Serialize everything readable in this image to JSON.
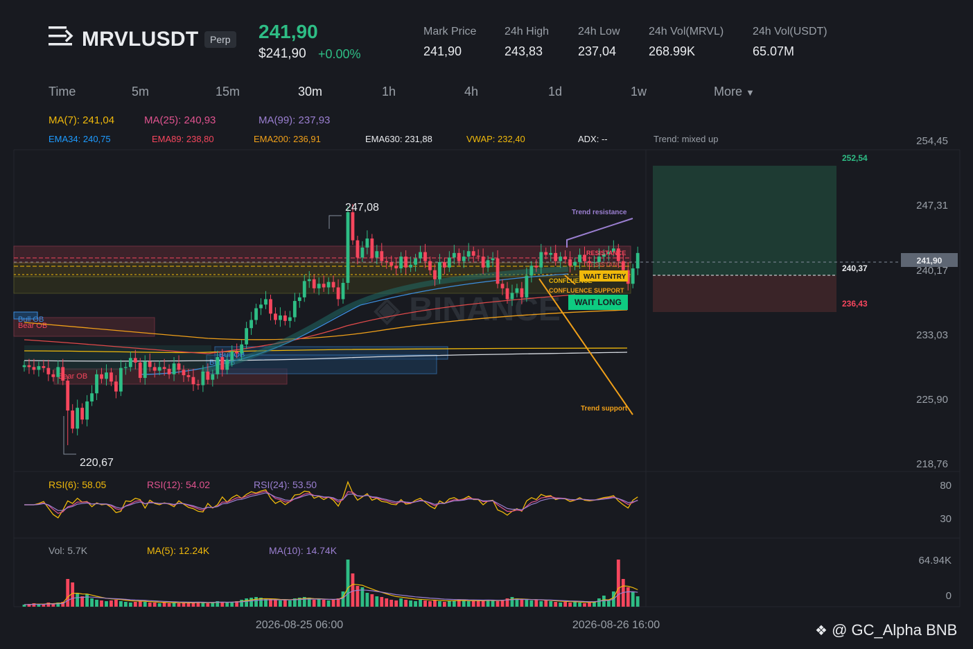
{
  "header": {
    "symbol": "MRVLUSDT",
    "badge": "Perp",
    "last_price": "241,90",
    "last_price_usd": "$241,90",
    "change_pct": "+0.00%",
    "stats": [
      {
        "label": "Mark Price",
        "value": "241,90"
      },
      {
        "label": "24h High",
        "value": "243,83"
      },
      {
        "label": "24h Low",
        "value": "237,04"
      },
      {
        "label": "24h Vol(MRVL)",
        "value": "268.99K"
      },
      {
        "label": "24h Vol(USDT)",
        "value": "65.07M"
      }
    ]
  },
  "timeframes": {
    "items": [
      "Time",
      "5m",
      "15m",
      "30m",
      "1h",
      "4h",
      "1d",
      "1w"
    ],
    "active": "30m",
    "more_label": "More",
    "more_icon": "caret-down-icon"
  },
  "indicators": {
    "ma7": "MA(7): 241,04",
    "ma25": "MA(25): 240,93",
    "ma99": "MA(99): 237,93",
    "ema34": "EMA34: 240,75",
    "ema89": "EMA89: 238,80",
    "ema200": "EMA200: 236,91",
    "ema630": "EMA630: 231,88",
    "vwap": "VWAP: 232,40",
    "adx": "ADX: --",
    "trend": "Trend: mixed up"
  },
  "colors": {
    "up": "#2ebd85",
    "down": "#f6465d",
    "ma7": "#f0b90b",
    "ma25": "#e0538f",
    "ma99": "#9b7fd1",
    "ema34": "#3d8fe0",
    "ema89": "#e04a4a",
    "ema200": "#f0a019",
    "ema630": "#d8dce2",
    "vwap": "#f0b90b",
    "ema34_text": "#1e9bff",
    "ema89_text": "#f6465d",
    "ema200_text": "#f0a019",
    "ema630_text": "#eaecef",
    "vwap_text": "#f0b90b"
  },
  "price_axis": {
    "ticks": [
      "254,45",
      "247,31",
      "240,17",
      "233,03",
      "225,90",
      "218,76"
    ],
    "current_price": "241,90"
  },
  "annotations": {
    "high_label": "247,08",
    "low_label": "220,67",
    "trend_resistance": "Trend resistance",
    "trend_support": "Trend support",
    "resistance_1": "RESISTANCE",
    "resistance_2": "RESISTANCE",
    "confluence_1": "CONFLUENCE",
    "confluence_support": "CONFLUENCE SUPPORT",
    "wait_entry": "WAIT ENTRY",
    "wait_long": "WAIT LONG",
    "bull_ob": "Bull OB",
    "bear_ob": "Bear OB",
    "bull_ob_2": "Bull OB",
    "bull_ob_3": "Bull OB",
    "bear_ob_2": "Bear OB",
    "target_price": "252,54",
    "entry_price": "240,37",
    "stop_price": "236,43"
  },
  "rsi": {
    "rsi6": "RSI(6): 58.05",
    "rsi12": "RSI(12): 54.02",
    "rsi24": "RSI(24): 53.50",
    "axis": [
      "80",
      "30"
    ]
  },
  "volume": {
    "vol": "Vol: 5.7K",
    "ma5": "MA(5): 12.24K",
    "ma10": "MA(10): 14.74K",
    "axis": [
      "64.94K",
      "0"
    ]
  },
  "time_axis": [
    "2026-08-25 06:00",
    "2026-08-26 16:00"
  ],
  "watermark": "@ GC_Alpha BNB",
  "watermark_icon": "binance-logo-icon",
  "chart_data": {
    "type": "candlestick",
    "pmin": 218.76,
    "pmax": 254.45,
    "target": 252.54,
    "entry": 240.37,
    "stop": 236.43,
    "high": 247.08,
    "low": 220.67,
    "closes": [
      229.5,
      229.3,
      229.0,
      229.4,
      229.2,
      228.5,
      228.2,
      229.3,
      227.8,
      224.5,
      222.5,
      224.8,
      223.5,
      225.5,
      226.4,
      228.5,
      228.0,
      228.7,
      227.7,
      226.6,
      229.2,
      229.3,
      230.3,
      229.8,
      228.1,
      229.9,
      229.3,
      228.9,
      229.3,
      229.1,
      228.5,
      229.7,
      229.0,
      228.4,
      228.2,
      227.4,
      227.3,
      228.8,
      227.9,
      228.5,
      230.4,
      229.0,
      230.1,
      231.0,
      230.8,
      231.8,
      233.6,
      234.5,
      235.8,
      236.2,
      236.8,
      235.2,
      234.5,
      235.0,
      234.4,
      234.8,
      236.6,
      237.0,
      238.8,
      239.0,
      238.0,
      238.5,
      238.1,
      238.7,
      238.1,
      236.8,
      238.6,
      246.4,
      243.3,
      241.4,
      242.5,
      243.5,
      241.4,
      242.1,
      241.0,
      240.9,
      240.5,
      240.2,
      241.5,
      240.3,
      240.6,
      241.3,
      242.0,
      241.0,
      240.0,
      239.0,
      240.9,
      240.3,
      241.4,
      241.9,
      241.0,
      241.5,
      242.1,
      241.6,
      241.5,
      240.3,
      241.1,
      241.3,
      238.5,
      238.0,
      236.8,
      237.5,
      238.0,
      237.0,
      239.4,
      240.5,
      240.3,
      242.0,
      241.7,
      241.9,
      241.0,
      241.5,
      241.2,
      240.5,
      240.9,
      241.7,
      241.0,
      240.8,
      240.9,
      241.5,
      241.8,
      242.0,
      242.4,
      241.0,
      240.0,
      238.5,
      240.2,
      241.9
    ],
    "rsi6": [
      50,
      50,
      50,
      52,
      55,
      45,
      35,
      30,
      42,
      56,
      52,
      60,
      54,
      55,
      47,
      53,
      50,
      51,
      46,
      38,
      40,
      56,
      55,
      60,
      58,
      45,
      57,
      52,
      50,
      53,
      51,
      47,
      56,
      51,
      46,
      44,
      40,
      39,
      52,
      45,
      50,
      62,
      54,
      61,
      65,
      60,
      66,
      70,
      68,
      71,
      73,
      60,
      52,
      56,
      50,
      55,
      65,
      66,
      71,
      70,
      60,
      63,
      58,
      62,
      57,
      48,
      62,
      85,
      68,
      57,
      62,
      67,
      57,
      60,
      55,
      54,
      51,
      50,
      58,
      51,
      52,
      57,
      60,
      54,
      48,
      44,
      56,
      52,
      59,
      61,
      57,
      59,
      63,
      58,
      58,
      50,
      56,
      57,
      42,
      39,
      34,
      40,
      44,
      40,
      56,
      61,
      58,
      66,
      63,
      64,
      58,
      60,
      59,
      55,
      57,
      61,
      57,
      56,
      57,
      59,
      61,
      62,
      64,
      56,
      50,
      45,
      57,
      62
    ],
    "volume": [
      3,
      4,
      5,
      4,
      4,
      6,
      5,
      6,
      7,
      40,
      35,
      20,
      15,
      18,
      12,
      10,
      9,
      8,
      9,
      10,
      8,
      7,
      6,
      7,
      8,
      7,
      6,
      6,
      5,
      6,
      5,
      6,
      5,
      6,
      5,
      6,
      7,
      6,
      5,
      6,
      8,
      7,
      6,
      7,
      8,
      10,
      12,
      13,
      14,
      13,
      12,
      11,
      10,
      9,
      10,
      9,
      12,
      13,
      14,
      13,
      10,
      11,
      10,
      9,
      10,
      12,
      22,
      68,
      48,
      30,
      28,
      20,
      18,
      15,
      14,
      12,
      10,
      9,
      12,
      10,
      9,
      8,
      10,
      9,
      8,
      9,
      8,
      7,
      8,
      9,
      10,
      9,
      8,
      9,
      8,
      9,
      10,
      9,
      8,
      10,
      12,
      14,
      12,
      11,
      10,
      9,
      10,
      8,
      9,
      8,
      7,
      6,
      7,
      6,
      7,
      6,
      5,
      6,
      7,
      12,
      16,
      10,
      22,
      68,
      40,
      28,
      22,
      15
    ]
  }
}
